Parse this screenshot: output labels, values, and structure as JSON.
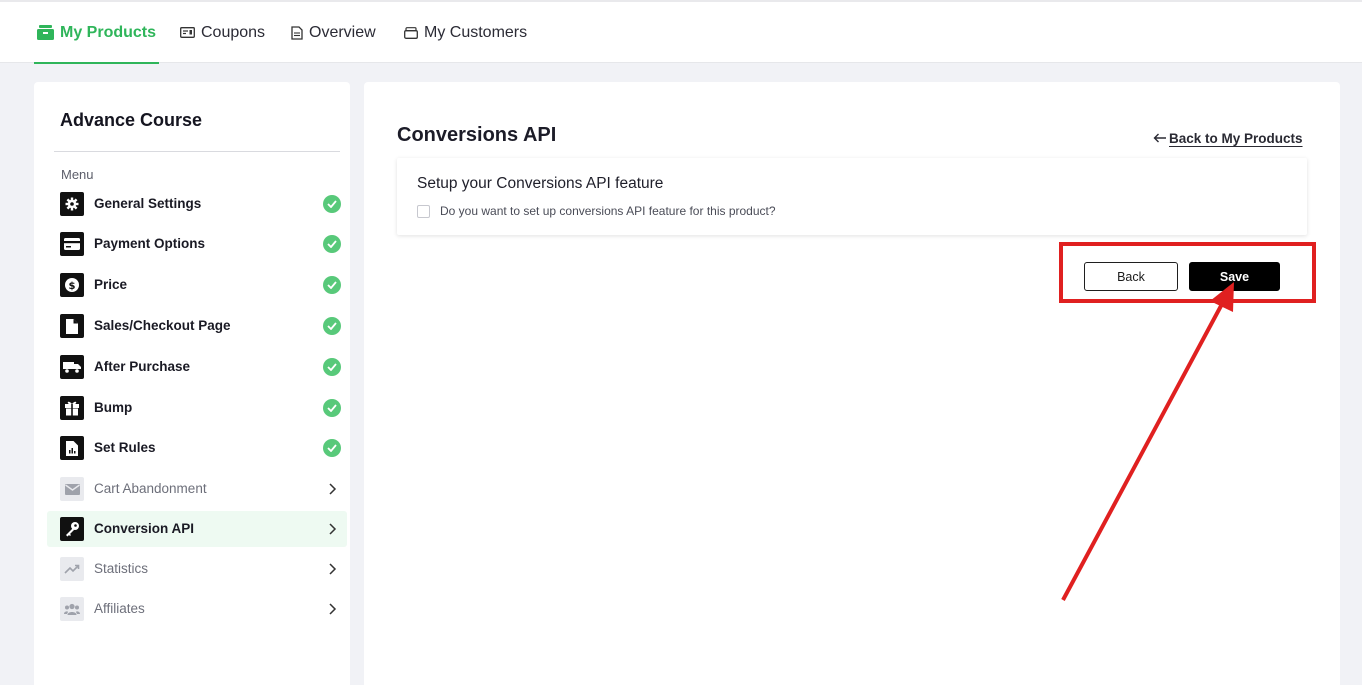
{
  "topnav": {
    "tabs": [
      {
        "label": "My Products",
        "icon": "products-icon",
        "active": true
      },
      {
        "label": "Coupons",
        "icon": "coupon-icon",
        "active": false
      },
      {
        "label": "Overview",
        "icon": "document-icon",
        "active": false
      },
      {
        "label": "My Customers",
        "icon": "customers-icon",
        "active": false
      }
    ]
  },
  "sidebar": {
    "course_title": "Advance Course",
    "menu_label": "Menu",
    "items": [
      {
        "label": "General Settings",
        "icon": "gear-icon",
        "status": "complete"
      },
      {
        "label": "Payment Options",
        "icon": "credit-card-icon",
        "status": "complete"
      },
      {
        "label": "Price",
        "icon": "dollar-icon",
        "status": "complete"
      },
      {
        "label": "Sales/Checkout Page",
        "icon": "file-icon",
        "status": "complete"
      },
      {
        "label": "After Purchase",
        "icon": "truck-icon",
        "status": "complete"
      },
      {
        "label": "Bump",
        "icon": "gift-icon",
        "status": "complete"
      },
      {
        "label": "Set Rules",
        "icon": "report-icon",
        "status": "complete"
      },
      {
        "label": "Cart Abandonment",
        "icon": "mail-icon",
        "status": "pending"
      },
      {
        "label": "Conversion API",
        "icon": "key-icon",
        "status": "selected"
      },
      {
        "label": "Statistics",
        "icon": "trend-icon",
        "status": "pending"
      },
      {
        "label": "Affiliates",
        "icon": "group-icon",
        "status": "pending"
      }
    ]
  },
  "main": {
    "title": "Conversions API",
    "back_link": "Back to My Products",
    "feature": {
      "title": "Setup your Conversions API feature",
      "question": "Do you want to set up conversions API feature for this product?",
      "checked": false
    },
    "buttons": {
      "back": "Back",
      "save": "Save"
    }
  },
  "colors": {
    "accent": "#2fb55a",
    "check": "#58c97a",
    "annotation": "#e02020"
  }
}
